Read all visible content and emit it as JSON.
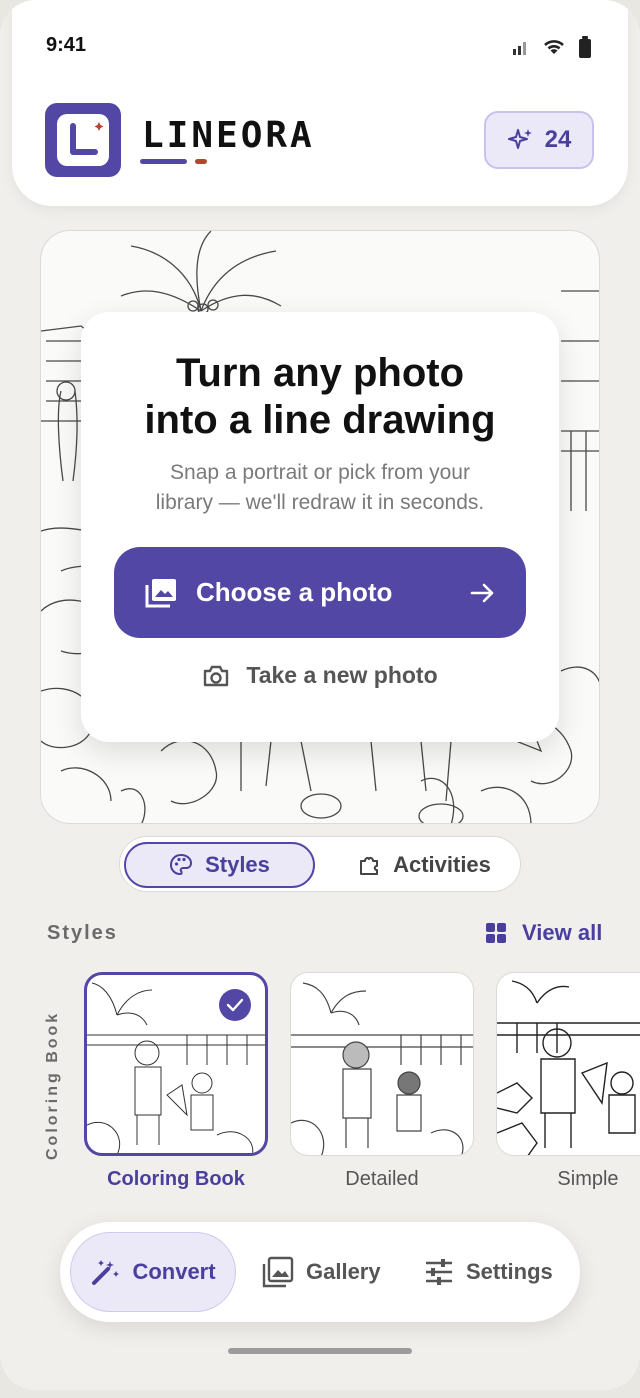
{
  "status": {
    "time": "9:41"
  },
  "header": {
    "brand": "LINEORA",
    "credits": "24",
    "colors": {
      "accent": "#5347a6",
      "accent2": "#b2472d"
    }
  },
  "hero": {
    "title_line1": "Turn any photo",
    "title_line2": "into a line drawing",
    "subtitle_line1": "Snap a portrait or pick from your",
    "subtitle_line2": "library — we'll redraw it in seconds.",
    "choose_label": "Choose a photo",
    "take_label": "Take a new photo"
  },
  "tabs": [
    {
      "label": "Styles",
      "active": true
    },
    {
      "label": "Activities",
      "active": false
    }
  ],
  "styles": {
    "heading": "Styles",
    "view_all": "View all",
    "vertical_label": "Coloring Book",
    "items": [
      {
        "label": "Coloring Book",
        "selected": true
      },
      {
        "label": "Detailed",
        "selected": false
      },
      {
        "label": "Simple",
        "selected": false
      }
    ]
  },
  "nav": [
    {
      "label": "Convert",
      "active": true,
      "icon": "magic-wand-icon"
    },
    {
      "label": "Gallery",
      "active": false,
      "icon": "image-icon"
    },
    {
      "label": "Settings",
      "active": false,
      "icon": "sliders-icon"
    }
  ]
}
